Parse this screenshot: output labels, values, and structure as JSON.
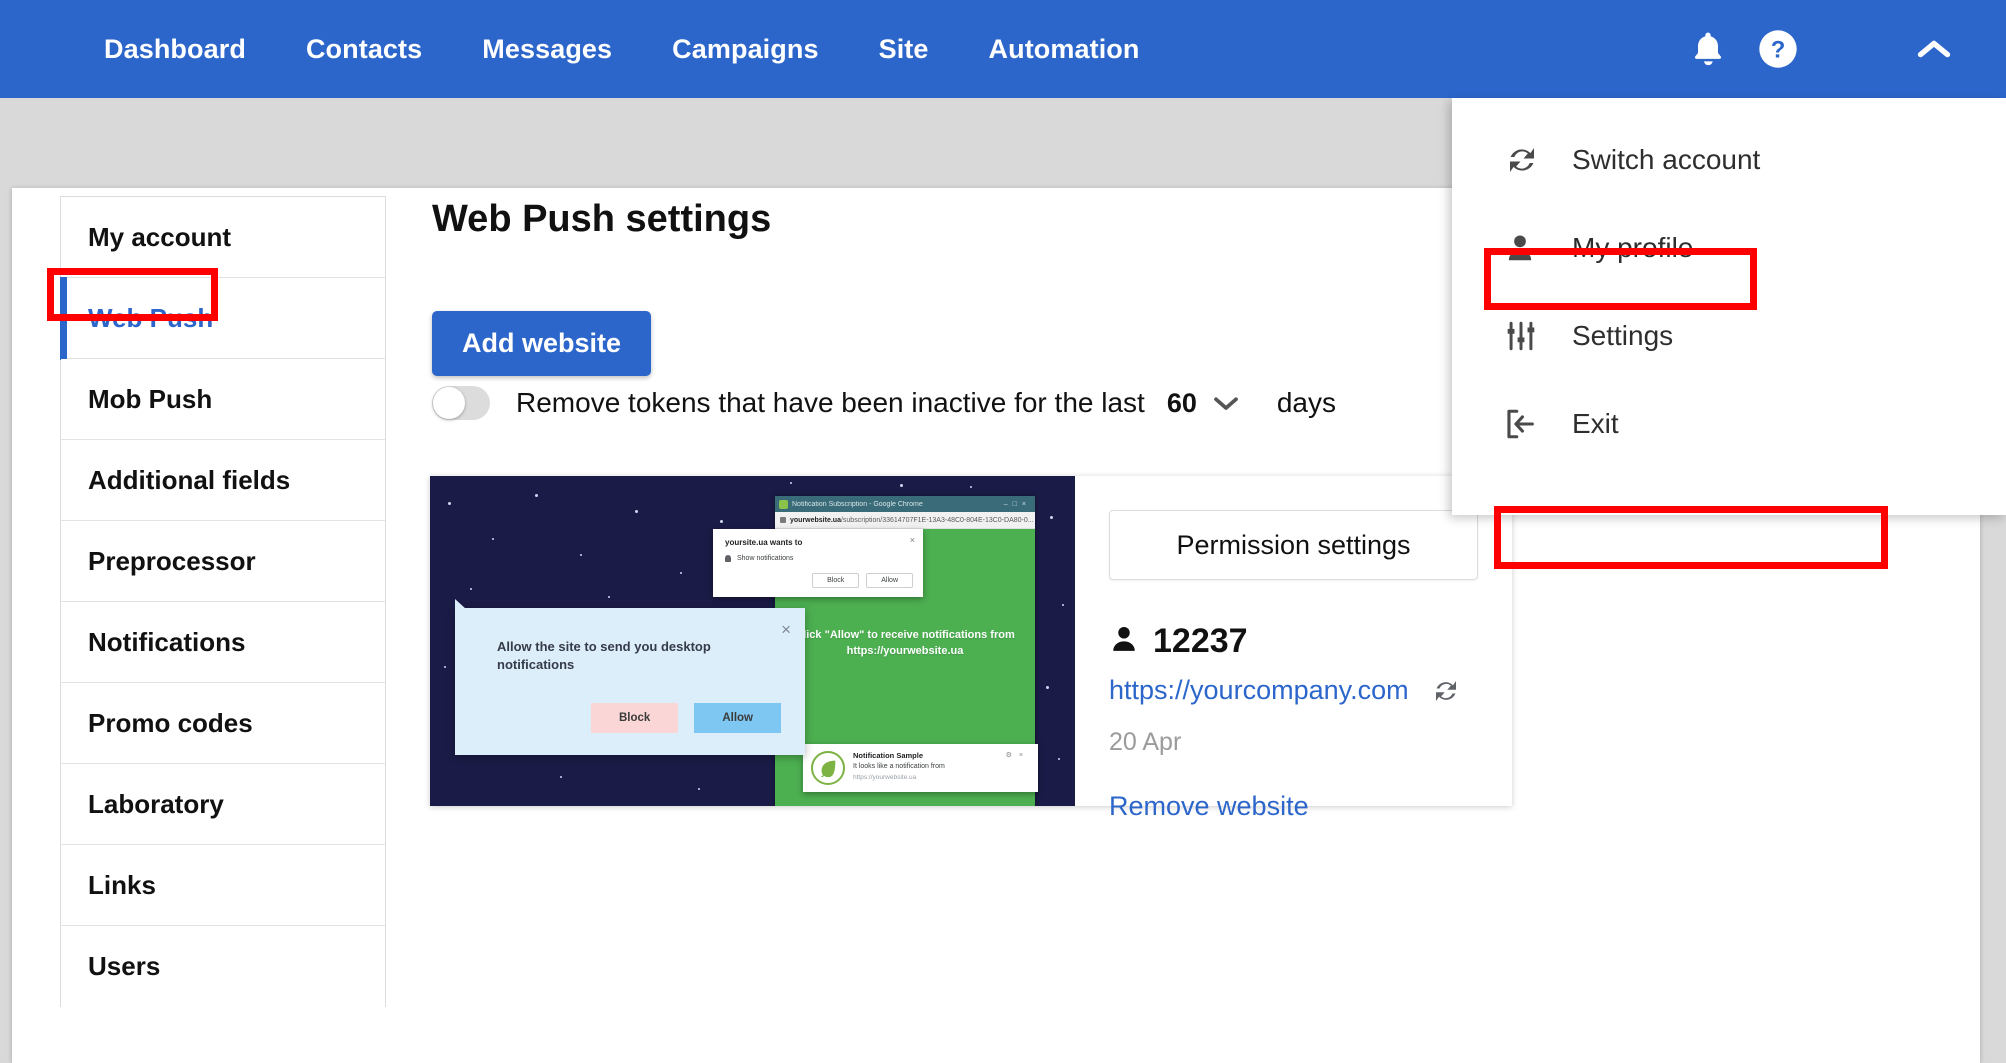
{
  "topbar": {
    "nav": [
      {
        "label": "Dashboard",
        "name": "dashboard"
      },
      {
        "label": "Contacts",
        "name": "contacts"
      },
      {
        "label": "Messages",
        "name": "messages"
      },
      {
        "label": "Campaigns",
        "name": "campaigns"
      },
      {
        "label": "Site",
        "name": "site"
      },
      {
        "label": "Automation",
        "name": "automation"
      }
    ],
    "icons": {
      "bell": "bell-icon",
      "help": "help-circle-icon",
      "caret": "chevron-up-icon"
    },
    "accent_color": "#2c66cb"
  },
  "account_menu": {
    "items": [
      {
        "label": "Switch account",
        "icon": "switch-account-icon"
      },
      {
        "label": "My profile",
        "icon": "person-icon"
      },
      {
        "label": "Settings",
        "icon": "sliders-icon"
      },
      {
        "label": "Exit",
        "icon": "exit-icon"
      }
    ],
    "highlighted": "Settings"
  },
  "sidebar": {
    "items": [
      {
        "label": "My account",
        "active": false
      },
      {
        "label": "Web Push",
        "active": true
      },
      {
        "label": "Mob Push",
        "active": false
      },
      {
        "label": "Additional fields",
        "active": false
      },
      {
        "label": "Preprocessor",
        "active": false
      },
      {
        "label": "Notifications",
        "active": false
      },
      {
        "label": "Promo codes",
        "active": false
      },
      {
        "label": "Laboratory",
        "active": false
      },
      {
        "label": "Links",
        "active": false
      },
      {
        "label": "Users",
        "active": false
      }
    ],
    "active_color": "#2c66cb"
  },
  "main": {
    "title": "Web Push settings",
    "add_website_label": "Add website",
    "token_cleanup": {
      "label": "Remove tokens that have been inactive for the last",
      "days_value": "60",
      "days_word": "days",
      "toggle_state": "off"
    }
  },
  "website_card": {
    "permission_button": "Permission settings",
    "subscribers": "12237",
    "url": "https://yourcompany.com",
    "date": "20 Apr",
    "remove_label": "Remove website",
    "preview": {
      "bubble_text": "Allow the site to send you desktop notifications",
      "bubble_block": "Block",
      "bubble_allow": "Allow",
      "chrome_title": "Notification Subscription - Google Chrome",
      "chrome_url_strong": "yourwebsite.ua",
      "chrome_url_rest": "/subscription/33614707F1E-13A3-48C0-804E-13C0-DA80-0...",
      "perm_title": "yoursite.ua wants to",
      "perm_row": "Show notifications",
      "perm_block": "Block",
      "perm_allow": "Allow",
      "green_text": "Click \"Allow\" to receive notifications from https://yourwebsite.ua",
      "notif_title": "Notification Sample",
      "notif_sub": "It looks like a notification from",
      "notif_url": "https://yourwebsite.ua"
    }
  },
  "annotations": {
    "color": "#ff0000",
    "boxes": [
      "Web Push",
      "Settings",
      "Permission settings"
    ]
  }
}
